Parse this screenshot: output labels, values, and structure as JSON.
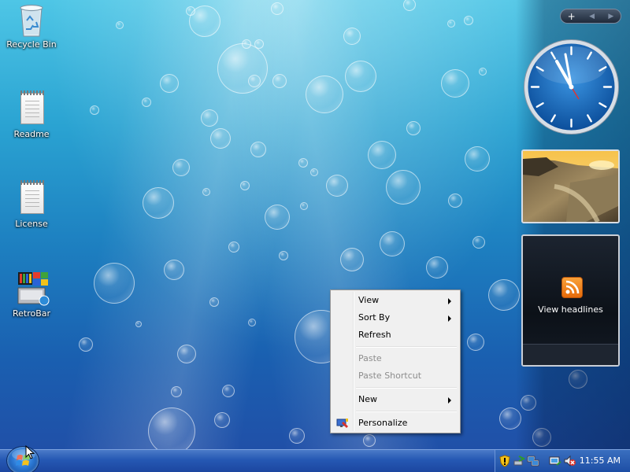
{
  "desktop": {
    "icons": [
      {
        "label": "Recycle Bin"
      },
      {
        "label": "Readme"
      },
      {
        "label": "License"
      },
      {
        "label": "RetroBar"
      }
    ]
  },
  "sidebar": {
    "controls": {
      "add_symbol": "+",
      "prev_symbol": "◀",
      "next_symbol": "▶"
    },
    "feed_gadget": {
      "headline_label": "View headlines"
    }
  },
  "context_menu": {
    "items": [
      {
        "label": "View"
      },
      {
        "label": "Sort By"
      },
      {
        "label": "Refresh"
      },
      {
        "label": "Paste"
      },
      {
        "label": "Paste Shortcut"
      },
      {
        "label": "New"
      },
      {
        "label": "Personalize"
      }
    ]
  },
  "taskbar": {
    "clock": "11:55 AM"
  },
  "icons": {
    "recycle_bin": "recycle-bin-icon",
    "readme": "text-document-icon",
    "license": "text-document-icon",
    "retrobar": "retrobar-app-icon",
    "start": "windows-start-orb-icon",
    "personalize": "personalize-icon",
    "rss": "rss-feed-icon"
  },
  "colors": {
    "menu_background": "#f0f0f0",
    "taskbar": "#2558b3",
    "disabled_text": "#8d8d8d"
  }
}
